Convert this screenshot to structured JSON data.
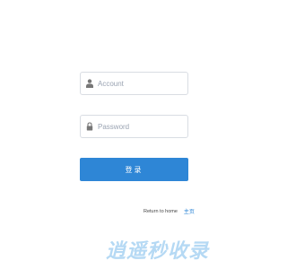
{
  "account": {
    "placeholder": "Account",
    "value": "",
    "icon": "user-icon"
  },
  "password": {
    "placeholder": "Password",
    "value": "",
    "icon": "lock-icon"
  },
  "login": {
    "label": "登录"
  },
  "return_home": {
    "text": "Return to home",
    "link_label": "主页"
  },
  "watermark": {
    "text": "逍遥秒收录"
  },
  "colors": {
    "accent": "#2e86d6",
    "border": "#d9dde3",
    "icon": "#777777",
    "watermark": "#78b9eb"
  }
}
